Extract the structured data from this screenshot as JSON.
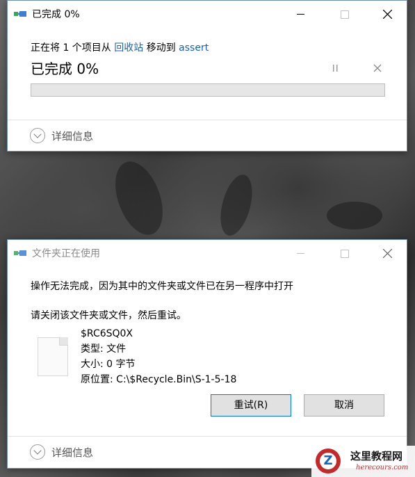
{
  "progress_dialog": {
    "title": "已完成 0%",
    "message_prefix": "正在将 1 个项目从 ",
    "source_link": "回收站",
    "message_middle": " 移动到 ",
    "dest_link": "assert",
    "status": "已完成 0%",
    "progress": 0,
    "pause_icon": "pause-icon",
    "cancel_icon": "close-icon",
    "details_label": "详细信息"
  },
  "in_use_dialog": {
    "title": "文件夹正在使用",
    "message": "操作无法完成，因为其中的文件夹或文件已在另一程序中打开",
    "instruction": "请关闭该文件夹或文件，然后重试。",
    "file_name": "$RC6SQ0X",
    "file_type": "类型: 文件",
    "file_size": "大小: 0 字节",
    "file_location": "原位置: C:\\$Recycle.Bin\\S-1-5-18",
    "retry_button": "重试(R)",
    "cancel_button": "取消",
    "details_label": "详细信息"
  },
  "watermark": {
    "site_cn": "这里教程网",
    "site_en": "herecours.com",
    "logo_letter": "Z"
  },
  "colors": {
    "link": "#1a62b3",
    "progress_track": "#e6e6e6",
    "window_border": "#6d8fb0"
  }
}
